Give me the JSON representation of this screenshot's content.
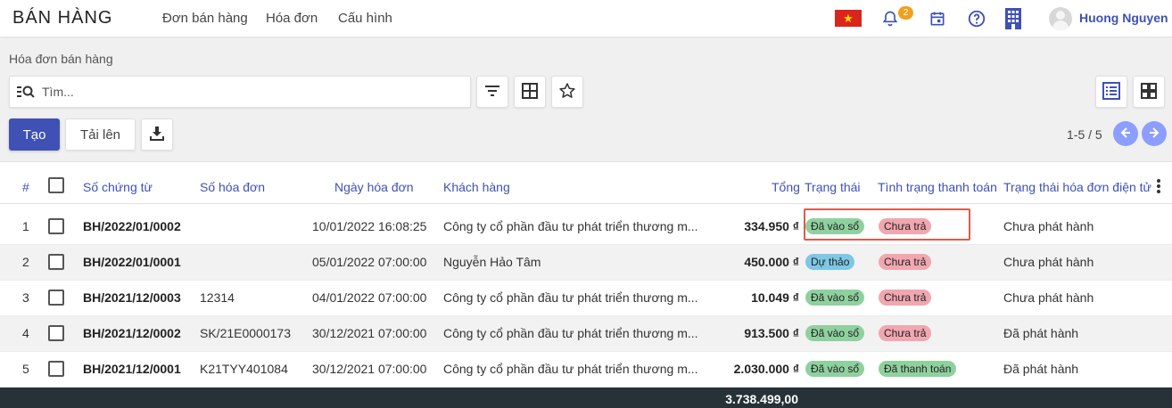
{
  "navbar": {
    "brand": "BÁN HÀNG",
    "menu": [
      "Đơn bán hàng",
      "Hóa đơn",
      "Cấu hình"
    ],
    "notification_count": "2",
    "user_name": "Huong Nguyen",
    "flag_color": "#da251d",
    "icons": [
      "vietnam-flag-icon",
      "bell-icon",
      "calendar-icon",
      "help-icon",
      "building-icon"
    ]
  },
  "control": {
    "breadcrumb": "Hóa đơn bán hàng",
    "search_placeholder": "Tìm...",
    "create_label": "Tạo",
    "upload_label": "Tải lên",
    "pager": "1-5 / 5"
  },
  "table": {
    "columns": {
      "index": "#",
      "doc_no": "Số chứng từ",
      "invoice_no": "Số hóa đơn",
      "invoice_date": "Ngày hóa đơn",
      "customer": "Khách hàng",
      "total": "Tổng",
      "status": "Trạng thái",
      "payment": "Tình trạng thanh toán",
      "einvoice": "Trạng thái hóa đơn điện tử"
    },
    "rows": [
      {
        "index": "1",
        "doc_no": "BH/2022/01/0002",
        "invoice_no": "",
        "invoice_date": "10/01/2022 16:08:25",
        "customer": "Công ty cổ phần đầu tư phát triển thương m...",
        "total": "334.950 ₫",
        "status": "Đã vào sổ",
        "status_color": "green",
        "payment": "Chưa trả",
        "payment_color": "pink",
        "einvoice": "Chưa phát hành"
      },
      {
        "index": "2",
        "doc_no": "BH/2022/01/0001",
        "invoice_no": "",
        "invoice_date": "05/01/2022 07:00:00",
        "customer": "Nguyễn Hảo Tâm",
        "total": "450.000 ₫",
        "status": "Dự thảo",
        "status_color": "blue",
        "payment": "Chưa trả",
        "payment_color": "pink",
        "einvoice": "Chưa phát hành"
      },
      {
        "index": "3",
        "doc_no": "BH/2021/12/0003",
        "invoice_no": "12314",
        "invoice_date": "04/01/2022 07:00:00",
        "customer": "Công ty cổ phần đầu tư phát triển thương m...",
        "total": "10.049 ₫",
        "status": "Đã vào sổ",
        "status_color": "green",
        "payment": "Chưa trả",
        "payment_color": "pink",
        "einvoice": "Chưa phát hành"
      },
      {
        "index": "4",
        "doc_no": "BH/2021/12/0002",
        "invoice_no": "SK/21E0000173",
        "invoice_date": "30/12/2021 07:00:00",
        "customer": "Công ty cổ phần đầu tư phát triển thương m...",
        "total": "913.500 ₫",
        "status": "Đã vào sổ",
        "status_color": "green",
        "payment": "Chưa trả",
        "payment_color": "pink",
        "einvoice": "Đã phát hành"
      },
      {
        "index": "5",
        "doc_no": "BH/2021/12/0001",
        "invoice_no": "K21TYY401084",
        "invoice_date": "30/12/2021 07:00:00",
        "customer": "Công ty cổ phần đầu tư phát triển thương m...",
        "total": "2.030.000 ₫",
        "status": "Đã vào sổ",
        "status_color": "green",
        "payment": "Đã thanh toán",
        "payment_color": "green",
        "einvoice": "Đã phát hành"
      }
    ],
    "footer_total": "3.738.499,00"
  },
  "colors": {
    "primary": "#3f51b5",
    "pager_button": "#8c9eff",
    "highlight": "#e05a4a",
    "footer_bg": "#263238"
  }
}
